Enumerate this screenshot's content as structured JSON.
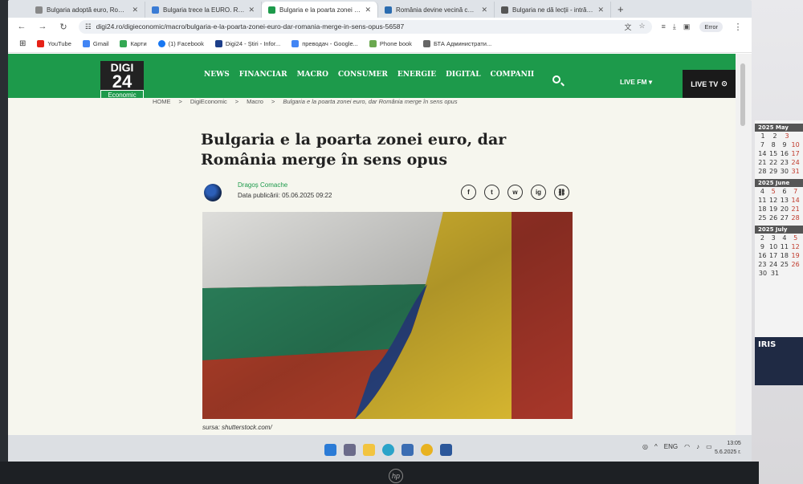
{
  "browser": {
    "tabs": [
      {
        "label": "Bulgaria adoptă euro, România",
        "active": false
      },
      {
        "label": "Bulgaria trece la EURO. Român",
        "active": false
      },
      {
        "label": "Bulgaria e la poarta zonei euro",
        "active": true
      },
      {
        "label": "România devine vecină cu zona",
        "active": false
      },
      {
        "label": "Bulgaria ne dă lecții - intră în zona",
        "active": false
      }
    ],
    "new_tab": "+",
    "url": "digi24.ro/digieconomic/macro/bulgaria-e-la-poarta-zonei-euro-dar-romania-merge-in-sens-opus-56587",
    "profile_label": "Error",
    "bookmarks": [
      {
        "label": "YouTube",
        "color": "#e62117"
      },
      {
        "label": "Gmail",
        "color": "#4285f4"
      },
      {
        "label": "Карти",
        "color": "#34a853"
      },
      {
        "label": "(1) Facebook",
        "color": "#1877f2"
      },
      {
        "label": "Digi24 - Știri - Infor...",
        "color": "#1d3f8a"
      },
      {
        "label": "преводач - Google...",
        "color": "#4285f4"
      },
      {
        "label": "Phone book",
        "color": "#6aa84f"
      },
      {
        "label": "БТА Администрати...",
        "color": "#666666"
      }
    ]
  },
  "site": {
    "logo": {
      "top": "DIGI",
      "number": "24",
      "sub": "Economic"
    },
    "nav": [
      "NEWS",
      "FINANCIAR",
      "MACRO",
      "CONSUMER",
      "ENERGIE",
      "DIGITAL",
      "COMPANII"
    ],
    "live_fm": "LIVE FM ▾",
    "live_tv": "LIVE TV",
    "accent": "#1d9a4b"
  },
  "article": {
    "breadcrumbs": [
      "HOME",
      ">",
      "DigiEconomic",
      ">",
      "Macro",
      ">",
      "Bulgaria e la poarta zonei euro, dar România merge în sens opus"
    ],
    "title": "Bulgaria e la poarta zonei euro, dar România merge în sens opus",
    "author": "Dragoș Comache",
    "published": "Data publicării: 05.06.2025 09:22",
    "shares": [
      "f",
      "t",
      "w",
      "ig",
      "⛓"
    ],
    "caption": "sursa: shutterstock.com/"
  },
  "taskbar": {
    "lang": "ENG",
    "time": "13:05",
    "date": "5.6.2025 г."
  },
  "calendar": {
    "months": [
      "2025 May",
      "2025 June",
      "2025 July"
    ],
    "ad_text": "IRIS"
  }
}
